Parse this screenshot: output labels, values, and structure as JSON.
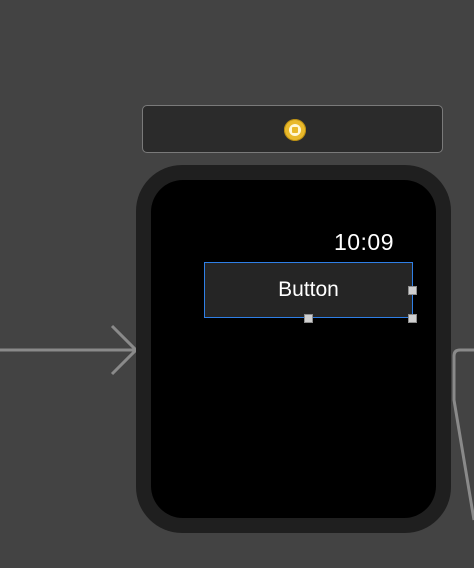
{
  "canvas": {
    "background": "#434343"
  },
  "scene_dock": {
    "icon": "interface-controller-icon",
    "icon_color": "#e9b92b"
  },
  "watch": {
    "status_time": "10:09",
    "button_label": "Button",
    "selection_color": "#2f7fe6"
  },
  "arrows": {
    "entry_point": "storyboard-entry-arrow",
    "segue": "segue-connector-line"
  }
}
